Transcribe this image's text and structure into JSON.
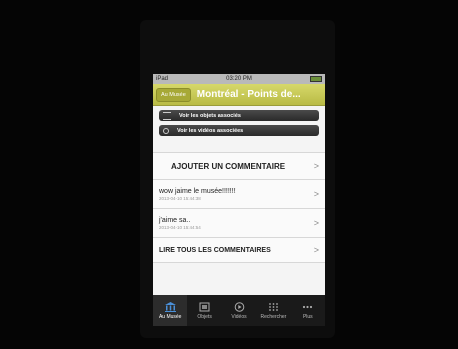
{
  "status": {
    "carrier": "iPad",
    "time": "03:20 PM"
  },
  "nav": {
    "back_label": "Au Musée",
    "title": "Montréal - Points de..."
  },
  "buttons": {
    "objects": "Voir les objets associés",
    "videos": "Voir les vidéos associées"
  },
  "add_comment": {
    "label": "AJOUTER UN COMMENTAIRE",
    "chevron": ">"
  },
  "comments": [
    {
      "text": "wow jaime le musée!!!!!!!",
      "date": "2013-04-10 15:44:38",
      "chevron": ">"
    },
    {
      "text": "j'aime sa..",
      "date": "2013-04-10 15:44:54",
      "chevron": ">"
    }
  ],
  "read_all": {
    "label": "LIRE TOUS LES COMMENTAIRES",
    "chevron": ">"
  },
  "tabs": [
    {
      "label": "Au Musée",
      "icon": "museum-icon"
    },
    {
      "label": "Objets",
      "icon": "objects-icon"
    },
    {
      "label": "Vidéos",
      "icon": "play-icon"
    },
    {
      "label": "Rechercher",
      "icon": "keypad-icon"
    },
    {
      "label": "Plus",
      "icon": "more-icon"
    }
  ],
  "colors": {
    "navbar": "#c8ca55",
    "tabbar": "#1a1a1a",
    "background": "#050505"
  }
}
